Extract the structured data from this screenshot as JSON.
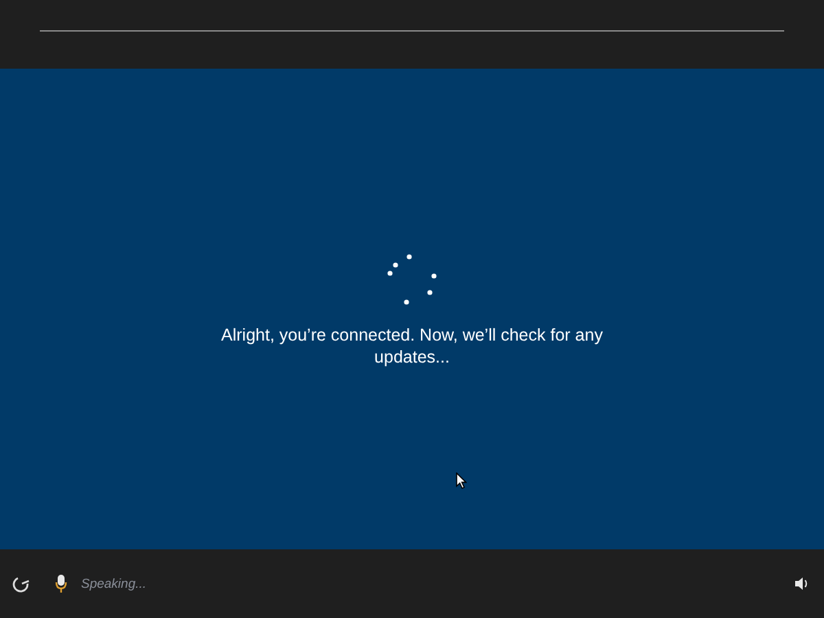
{
  "message": "Alright, you’re connected. Now, we’ll check for any updates...",
  "bottom_bar": {
    "speech_status": "Speaking..."
  }
}
